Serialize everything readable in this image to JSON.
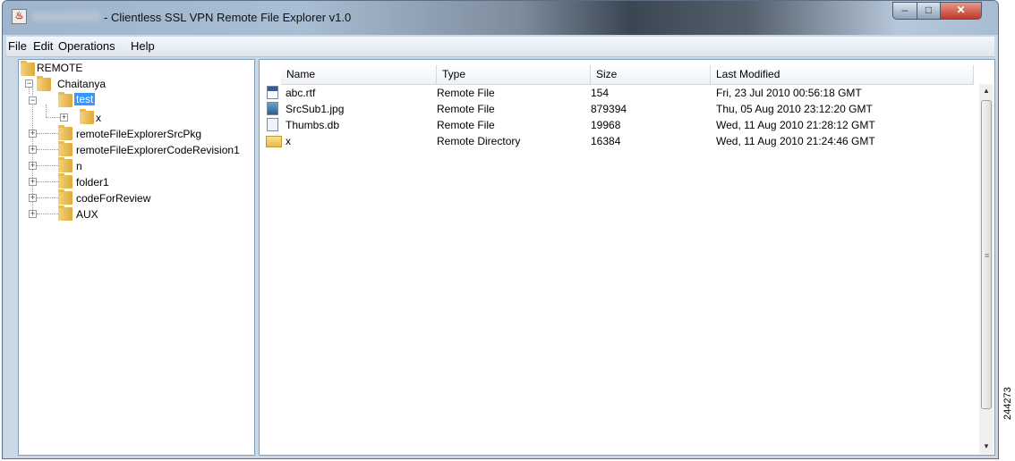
{
  "window": {
    "title": "- Clientless SSL VPN Remote File Explorer v1.0"
  },
  "menubar": [
    "File",
    "Edit",
    "Operations",
    "Help"
  ],
  "tree": {
    "root": "REMOTE",
    "user_folder": "Chaitanya",
    "selected": "test",
    "test_child": "x",
    "siblings": [
      "remoteFileExplorerSrcPkg",
      "remoteFileExplorerCodeRevision1",
      "n",
      "folder1",
      "codeForReview",
      "AUX"
    ]
  },
  "table": {
    "columns": [
      "Name",
      "Type",
      "Size",
      "Last Modified"
    ],
    "rows": [
      {
        "icon": "rtf-file-icon",
        "name": "abc.rtf",
        "type": "Remote File",
        "size": "154",
        "modified": "Fri, 23 Jul 2010 00:56:18 GMT"
      },
      {
        "icon": "jpg-file-icon",
        "name": "SrcSub1.jpg",
        "type": "Remote File",
        "size": "879394",
        "modified": "Thu, 05 Aug 2010 23:12:20 GMT"
      },
      {
        "icon": "db-file-icon",
        "name": "Thumbs.db",
        "type": "Remote File",
        "size": "19968",
        "modified": "Wed, 11 Aug 2010 21:28:12 GMT"
      },
      {
        "icon": "folder-icon",
        "name": "x",
        "type": "Remote Directory",
        "size": "16384",
        "modified": "Wed, 11 Aug 2010 21:24:46 GMT"
      }
    ]
  },
  "figure_id": "244273",
  "colors": {
    "selection": "#3399ff",
    "folder": "#e0a93c",
    "window_frame": "#c9d7e6"
  }
}
